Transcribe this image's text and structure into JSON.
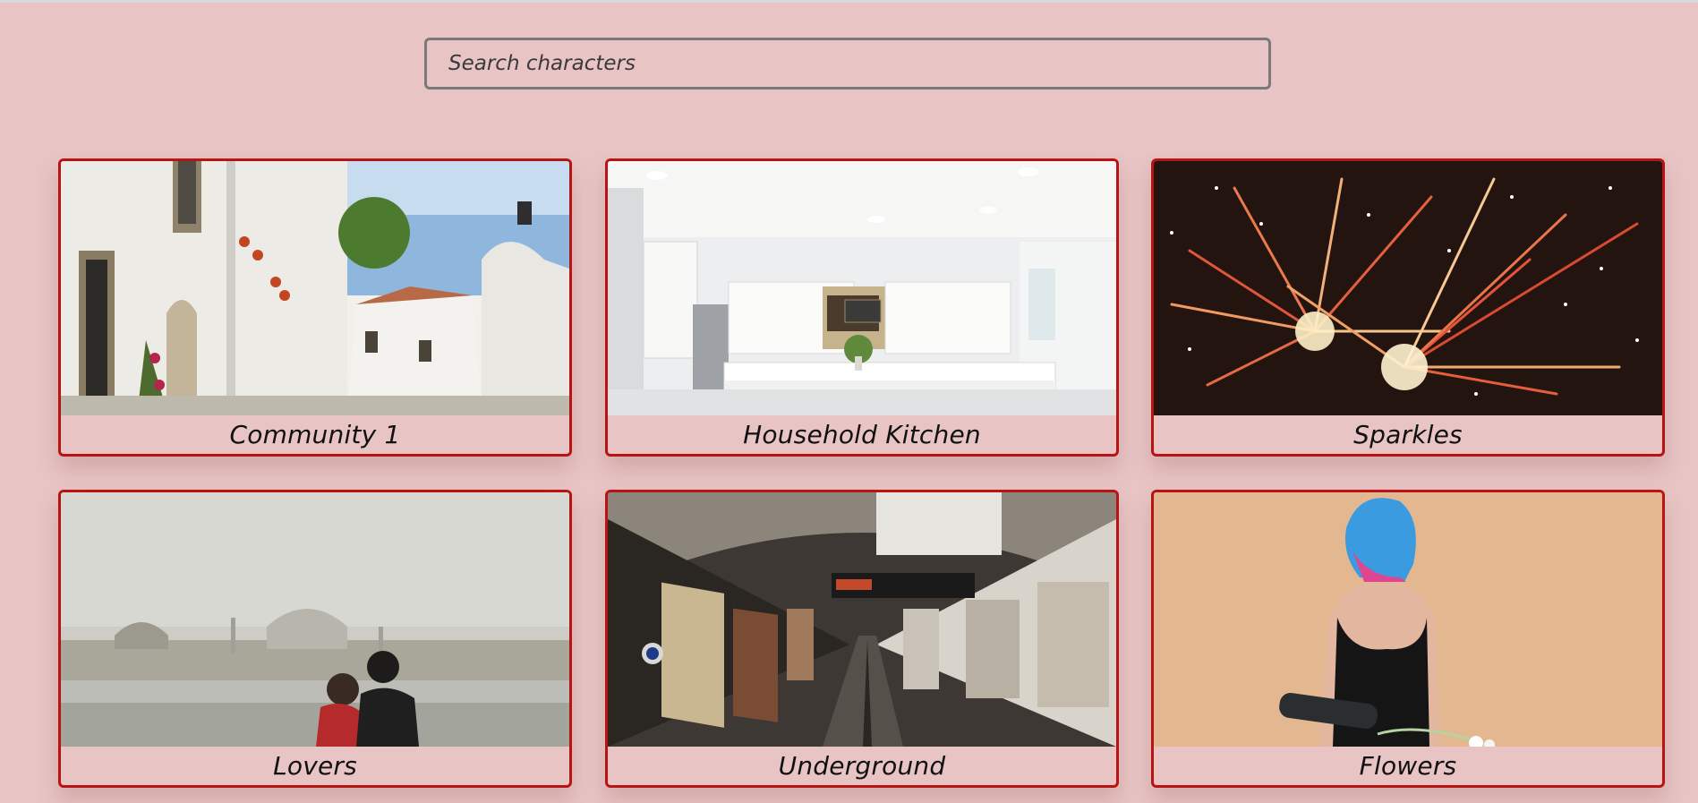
{
  "search": {
    "placeholder": "Search characters",
    "value": ""
  },
  "cards": [
    {
      "title": "Community 1",
      "image": "whitewashed-village-street-photo"
    },
    {
      "title": "Household Kitchen",
      "image": "white-kitchen-interior-photo"
    },
    {
      "title": "Sparkles",
      "image": "fireworks-night-photo"
    },
    {
      "title": "Lovers",
      "image": "couple-foggy-taj-mahal-photo"
    },
    {
      "title": "Underground",
      "image": "subway-tunnel-platform-photo"
    },
    {
      "title": "Flowers",
      "image": "blue-haired-woman-flowers-photo"
    }
  ],
  "colors": {
    "background": "#e8c4c4",
    "card_border": "#b81414",
    "search_border": "#7a7a7a"
  }
}
